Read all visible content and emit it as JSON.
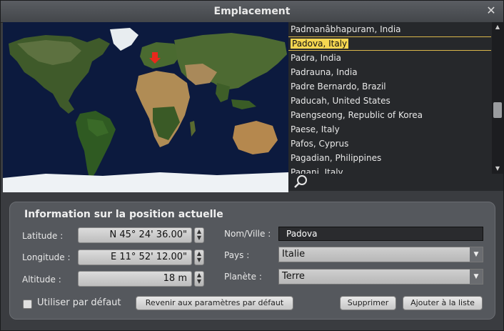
{
  "window": {
    "title": "Emplacement",
    "close": "✕"
  },
  "list": {
    "items": [
      "Padmanâbhapuram, India",
      "Padova, Italy",
      "Padra, India",
      "Padrauna, India",
      "Padre Bernardo, Brazil",
      "Paducah, United States",
      "Paengseong, Republic of Korea",
      "Paese, Italy",
      "Pafos, Cyprus",
      "Pagadian, Philippines",
      "Pagani, Italy"
    ],
    "selected_index": 1
  },
  "panel": {
    "title": "Information sur la position actuelle",
    "latitude_label": "Latitude :",
    "latitude_value": "N 45° 24' 36.00\"",
    "longitude_label": "Longitude :",
    "longitude_value": "E 11° 52' 12.00\"",
    "altitude_label": "Altitude :",
    "altitude_value": "18 m",
    "name_label": "Nom/Ville :",
    "name_value": "Padova",
    "country_label": "Pays :",
    "country_value": "Italie",
    "planet_label": "Planète :",
    "planet_value": "Terre",
    "default_checkbox_label": "Utiliser par défaut",
    "reset_button": "Revenir aux paramètres par défaut",
    "delete_button": "Supprimer",
    "add_button": "Ajouter à la liste"
  },
  "icons": {
    "search": "search-icon",
    "marker": "location-marker-icon"
  },
  "colors": {
    "accent": "#f5d650",
    "marker": "#e8281c",
    "ocean": "#0c1a3e"
  }
}
